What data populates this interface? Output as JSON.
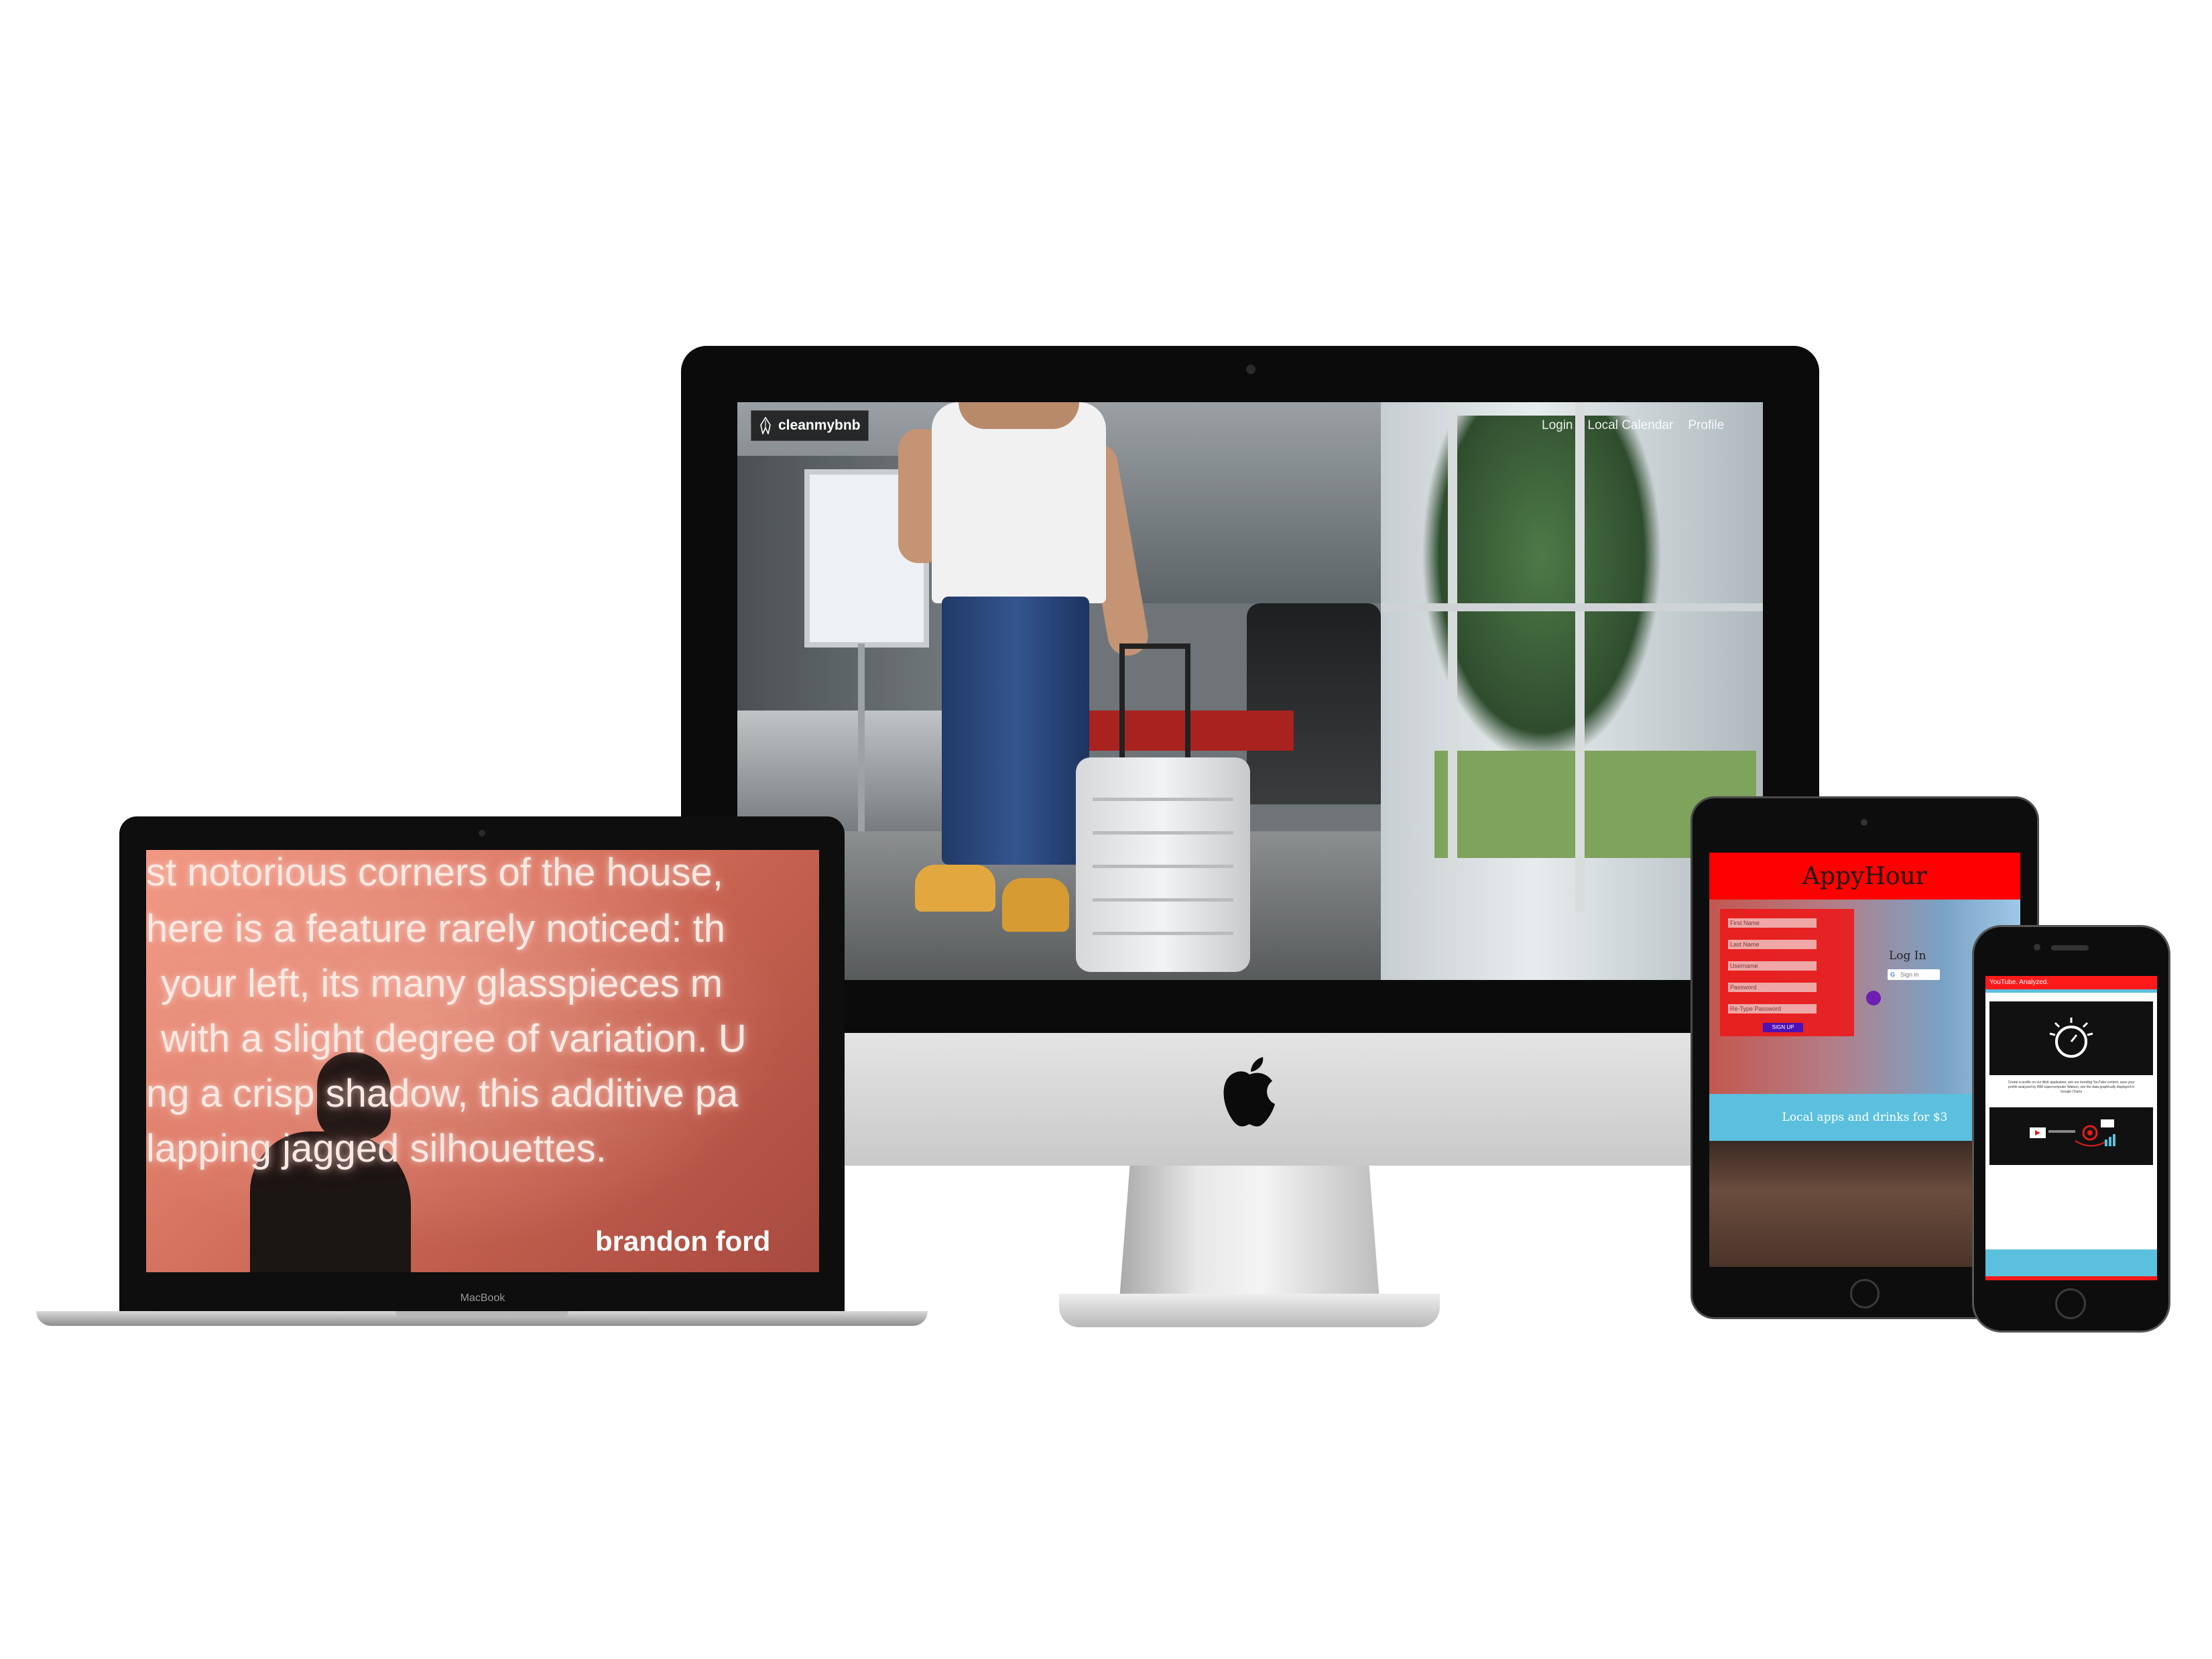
{
  "imac": {
    "brand": "cleanmybnb",
    "brand_icon": "cleaning-logo-icon",
    "nav": [
      "Login",
      "Local Calendar",
      "Profile"
    ]
  },
  "macbook": {
    "lines": [
      "st notorious corners of the house,",
      "here is a feature rarely noticed: th",
      "your left, its many glasspieces m",
      "with a slight degree of variation. U",
      "ng a crisp shadow, this additive pa",
      "lapping jagged silhouettes."
    ],
    "signature": "brandon ford",
    "label": "MacBook"
  },
  "ipad": {
    "title": "AppyHour",
    "fields": [
      "First Name",
      "Last Name",
      "Username",
      "Password",
      "Re-Type Password"
    ],
    "signup": "SIGN UP",
    "login_heading": "Log In",
    "google_button": "Sign in",
    "tagline": "Local apps and drinks for $3",
    "colors": {
      "header": "#ff0000",
      "tagline_bar": "#5bc0de",
      "signup": "#4d11b5"
    }
  },
  "iphone": {
    "app_title": "YouTube. Analyzed.",
    "icon": "stopwatch-icon",
    "copy": "Create a profile on our Web application, see our trending YouTube content, save your profile analyzed by IBM supercomputer Watson, see the data graphically displayed in Google Charts",
    "colors": {
      "accent": "#ff1a1a",
      "teal": "#5bc0de"
    }
  }
}
